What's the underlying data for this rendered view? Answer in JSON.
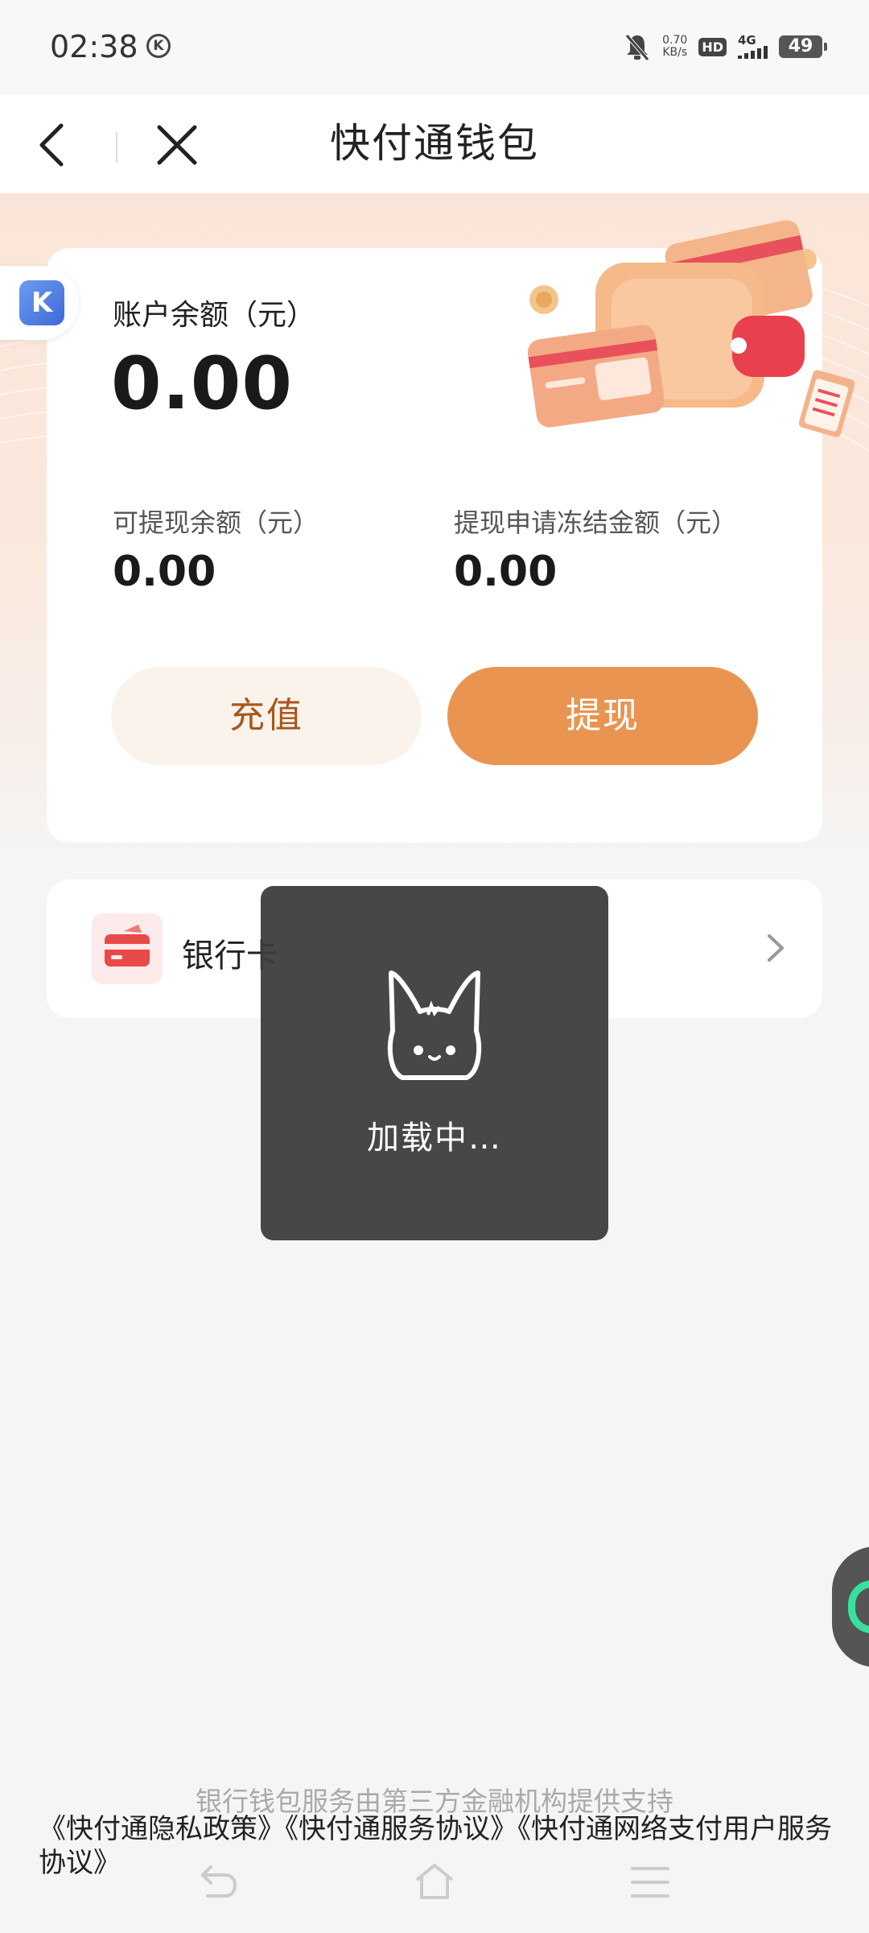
{
  "status_bar": {
    "time": "02:38",
    "k_badge": "K",
    "net_speed_value": "0.70",
    "net_speed_unit": "KB/s",
    "hd_label": "HD",
    "network_label": "4G",
    "battery_level": "49"
  },
  "nav": {
    "title": "快付通钱包"
  },
  "balance_card": {
    "side_logo_letter": "K",
    "balance_label": "账户余额（元）",
    "balance_value": "0.00",
    "withdrawable_label": "可提现余额（元）",
    "withdrawable_value": "0.00",
    "frozen_label": "提现申请冻结金额（元）",
    "frozen_value": "0.00",
    "recharge_label": "充值",
    "withdraw_label": "提现"
  },
  "bank_card_row": {
    "label": "银行卡"
  },
  "loading_toast": {
    "text": "加载中…"
  },
  "footer": {
    "support_text": "银行钱包服务由第三方金融机构提供支持",
    "links": [
      "《快付通隐私政策》",
      "《快付通服务协议》",
      "《快付通网络支付用户服务协议》"
    ]
  },
  "colors": {
    "accent": "#e99551",
    "recharge_text": "#a8561d",
    "recharge_bg": "#faf3ec",
    "bank_icon": "#e84a4a",
    "toast_bg": "#3c3c3c"
  }
}
